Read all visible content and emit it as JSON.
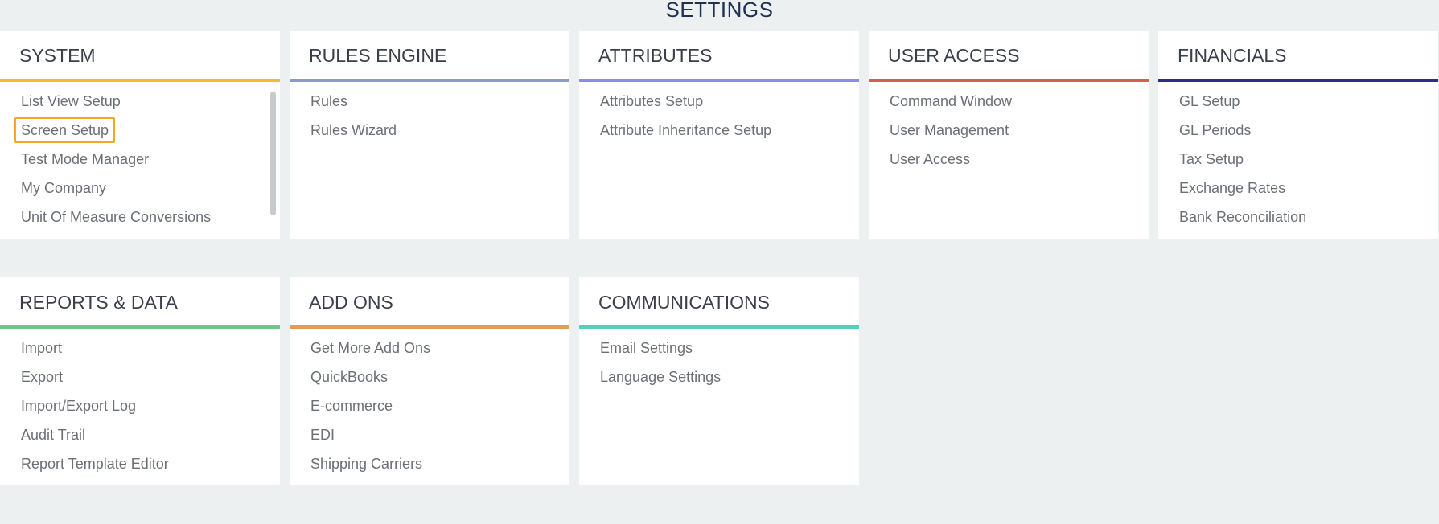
{
  "page": {
    "title": "SETTINGS"
  },
  "sections": [
    {
      "title": "SYSTEM",
      "accent": "#f7b733",
      "items": [
        "List View Setup",
        "Screen Setup",
        "Test Mode Manager",
        "My Company",
        "Unit Of Measure Conversions"
      ],
      "selected_index": 1,
      "has_scrollbar": true
    },
    {
      "title": "RULES ENGINE",
      "accent": "#8c9ac4",
      "items": [
        "Rules",
        "Rules Wizard"
      ]
    },
    {
      "title": "ATTRIBUTES",
      "accent": "#8a8ee8",
      "items": [
        "Attributes Setup",
        "Attribute Inheritance Setup"
      ]
    },
    {
      "title": "USER ACCESS",
      "accent": "#d2604c",
      "items": [
        "Command Window",
        "User Management",
        "User Access"
      ]
    },
    {
      "title": "FINANCIALS",
      "accent": "#2f2c8f",
      "items": [
        "GL Setup",
        "GL Periods",
        "Tax Setup",
        "Exchange Rates",
        "Bank Reconciliation"
      ]
    },
    {
      "title": "REPORTS & DATA",
      "accent": "#6cc788",
      "items": [
        "Import",
        "Export",
        "Import/Export Log",
        "Audit Trail",
        "Report Template Editor"
      ]
    },
    {
      "title": "ADD ONS",
      "accent": "#e89c4c",
      "items": [
        "Get More Add Ons",
        "QuickBooks",
        "E-commerce",
        "EDI",
        "Shipping Carriers"
      ]
    },
    {
      "title": "COMMUNICATIONS",
      "accent": "#4fd1be",
      "items": [
        "Email Settings",
        "Language Settings"
      ]
    }
  ]
}
